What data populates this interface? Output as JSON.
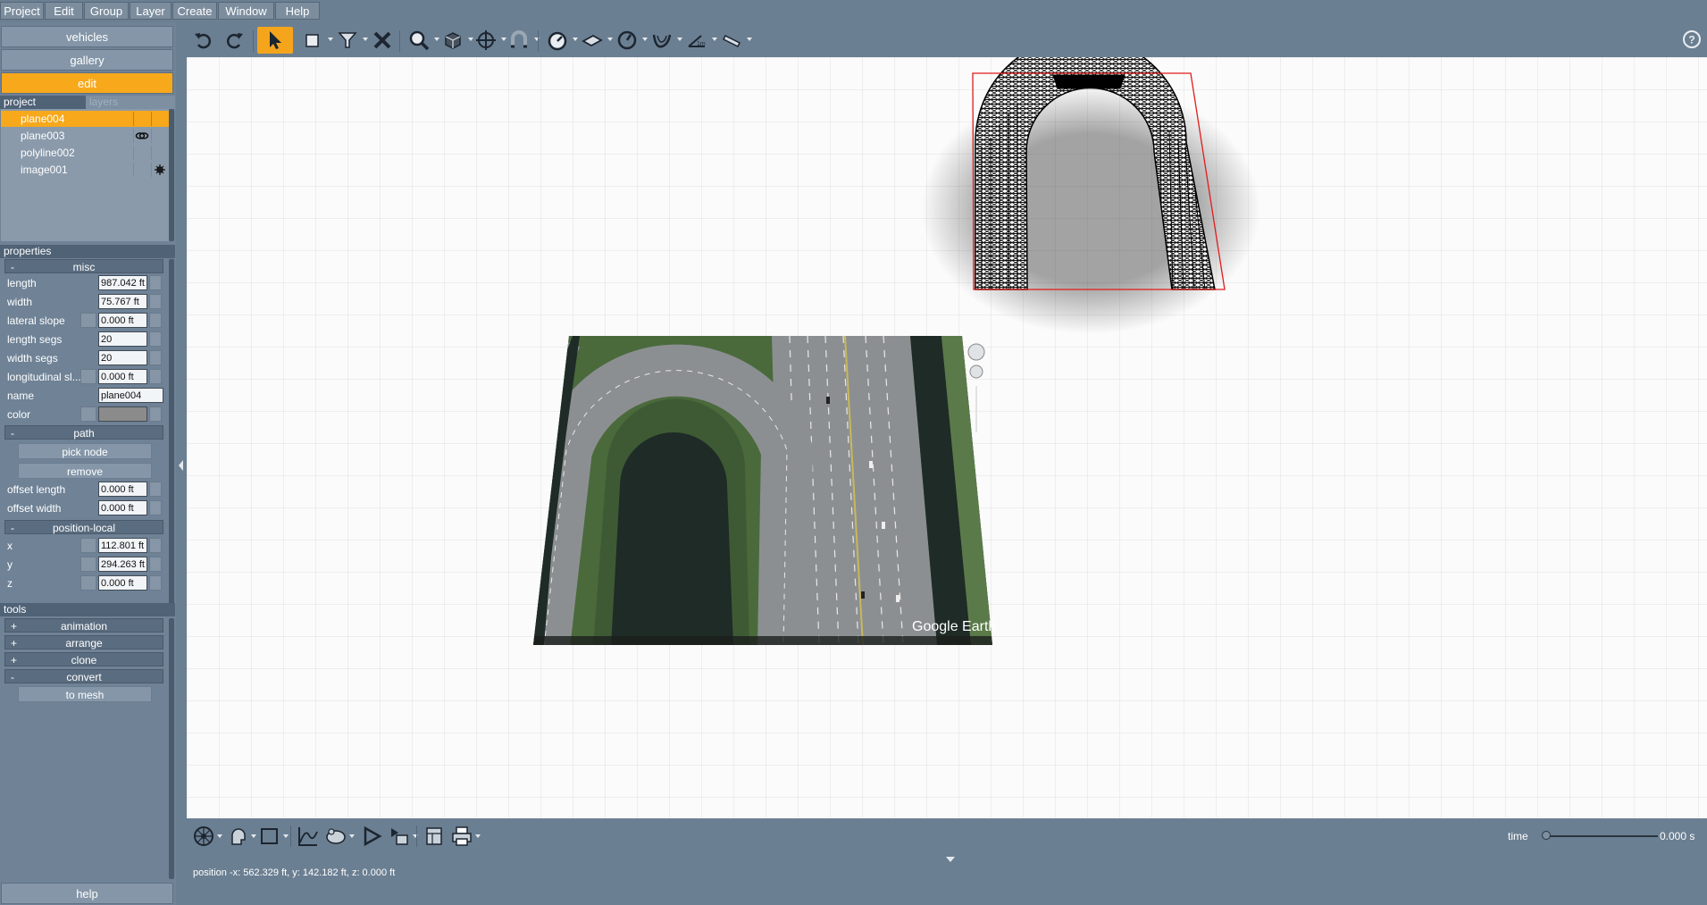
{
  "menu": [
    "Project",
    "Edit",
    "Group",
    "Layer",
    "Create",
    "Window",
    "Help"
  ],
  "nav": {
    "vehicles": "vehicles",
    "gallery": "gallery",
    "edit": "edit",
    "help": "help"
  },
  "tabs": {
    "project": "project",
    "layers": "layers"
  },
  "tree": [
    {
      "label": "plane004",
      "selected": true
    },
    {
      "label": "plane003",
      "selected": false,
      "icon": "chain-icon"
    },
    {
      "label": "polyline002",
      "selected": false
    },
    {
      "label": "image001",
      "selected": false,
      "icon": "gear-icon"
    }
  ],
  "properties": {
    "header": "properties",
    "misc": {
      "title": "misc",
      "length_label": "length",
      "length": "987.042 ft",
      "width_label": "width",
      "width": "75.767 ft",
      "lateral_label": "lateral slope",
      "lateral": "0.000 ft",
      "lsegs_label": "length segs",
      "lsegs": "20",
      "wsegs_label": "width segs",
      "wsegs": "20",
      "long_label": "longitudinal sl...",
      "long": "0.000 ft",
      "name_label": "name",
      "name": "plane004",
      "color_label": "color",
      "color": "#8b8b8b"
    },
    "path": {
      "title": "path",
      "pick": "pick node",
      "remove": "remove",
      "olength_label": "offset length",
      "olength": "0.000 ft",
      "owidth_label": "offset width",
      "owidth": "0.000 ft"
    },
    "position": {
      "title": "position-local",
      "x_label": "x",
      "x": "112.801 ft",
      "y_label": "y",
      "y": "294.263 ft",
      "z_label": "z",
      "z": "0.000 ft"
    }
  },
  "tools": {
    "header": "tools",
    "animation": "animation",
    "arrange": "arrange",
    "clone": "clone",
    "convert": "convert",
    "to_mesh": "to mesh"
  },
  "toolbar_icons": [
    "undo-icon",
    "redo-icon",
    "select-arrow-icon",
    "rectangle-icon",
    "filter-icon",
    "delete-x-icon",
    "zoom-icon",
    "box-icon",
    "crosshair-icon",
    "magnet-icon",
    "gauge-icon",
    "plane-tool-icon",
    "dial-icon",
    "curve-tool-icon",
    "angle-tool-icon",
    "ruler-icon",
    "help-icon"
  ],
  "viewport": {
    "watermark": "Google Earth",
    "map_colors": {
      "road": "#8c8f92",
      "water": "#1f2b26",
      "vegetation": "#3e5a34",
      "lane": "#e8e8e8"
    }
  },
  "timeline": {
    "label": "time",
    "value": "0.000 s"
  },
  "status": "position -x: 562.329 ft, y: 142.182 ft, z: 0.000 ft"
}
